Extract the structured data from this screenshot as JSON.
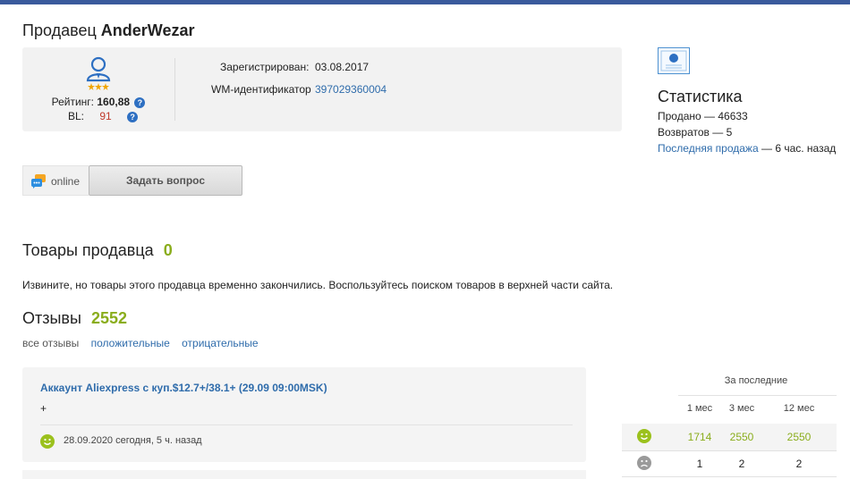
{
  "header": {
    "title_prefix": "Продавец",
    "seller_name": "AnderWezar"
  },
  "profile": {
    "rating_label": "Рейтинг:",
    "rating_value": "160,88",
    "bl_label": "BL:",
    "bl_value": "91",
    "help_glyph": "?",
    "registered_label": "Зарегистрирован:",
    "registered_value": "03.08.2017",
    "wm_label": "WM-идентификатор",
    "wm_value": "397029360004",
    "avatar_icon": "user-avatar-icon",
    "star_count": 3
  },
  "stats": {
    "title": "Статистика",
    "sold": "Продано — 46633",
    "returns": "Возвратов — 5",
    "last_sale_link": "Последняя продажа",
    "last_sale_value": "— 6 час. назад"
  },
  "contact": {
    "status": "online",
    "ask_button": "Задать вопрос"
  },
  "goods": {
    "title": "Товары продавца",
    "count": "0",
    "note": "Извините, но товары этого продавца временно закончились. Воспользуйтесь поиском товаров в верхней части сайта."
  },
  "reviews": {
    "title": "Отзывы",
    "count": "2552",
    "filters": [
      "все отзывы",
      "положительные",
      "отрицательные"
    ],
    "items": [
      {
        "title": "Аккаунт Aliexpress с куп.$12.7+/38.1+ (29.09 09:00MSK)",
        "text": "+",
        "date": "28.09.2020 сегодня, 5 ч. назад",
        "sentiment": "positive"
      }
    ]
  },
  "review_stats": {
    "header": "За последние",
    "columns": [
      "1 мес",
      "3 мес",
      "12 мес"
    ],
    "rows": [
      {
        "type": "positive",
        "values": [
          "1714",
          "2550",
          "2550"
        ]
      },
      {
        "type": "negative",
        "values": [
          "1",
          "2",
          "2"
        ]
      }
    ]
  },
  "colors": {
    "accent_blue": "#2f6cab",
    "top_bar": "#3a5a9c",
    "positive_green": "#8aad1c",
    "bl_red": "#c0392b"
  }
}
